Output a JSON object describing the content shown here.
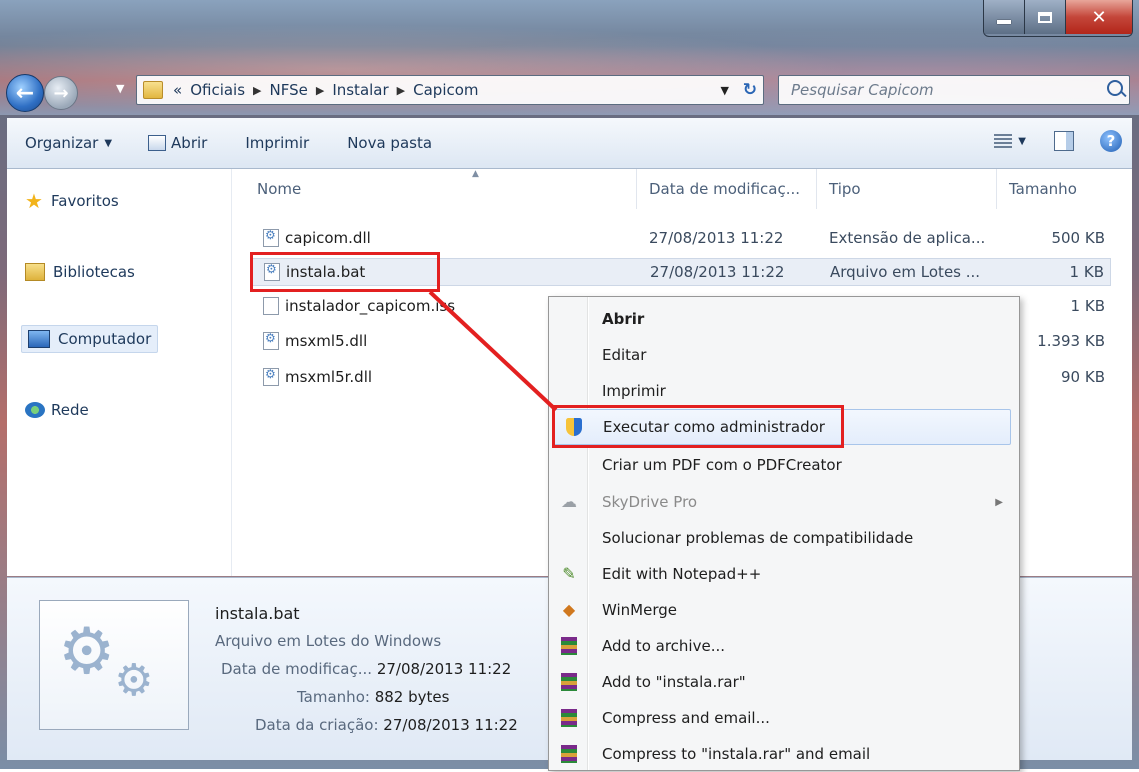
{
  "address": {
    "breadcrumb_prefix": "«",
    "crumbs": [
      "Oficiais",
      "NFSe",
      "Instalar",
      "Capicom"
    ],
    "search_placeholder": "Pesquisar Capicom"
  },
  "toolbar": {
    "organize_label": "Organizar",
    "open_label": "Abrir",
    "print_label": "Imprimir",
    "new_folder_label": "Nova pasta"
  },
  "navpane": {
    "items": [
      "Favoritos",
      "Bibliotecas",
      "Computador",
      "Rede"
    ]
  },
  "columns": [
    "Nome",
    "Data de modificaç...",
    "Tipo",
    "Tamanho"
  ],
  "files": [
    {
      "name": "capicom.dll",
      "date": "27/08/2013 11:22",
      "type": "Extensão de aplica...",
      "size": "500 KB"
    },
    {
      "name": "instala.bat",
      "date": "27/08/2013 11:22",
      "type": "Arquivo em Lotes ...",
      "size": "1 KB"
    },
    {
      "name": "instalador_capicom.iss",
      "date": "",
      "type": "",
      "size": "1 KB"
    },
    {
      "name": "msxml5.dll",
      "date": "",
      "type": "",
      "size": "1.393 KB"
    },
    {
      "name": "msxml5r.dll",
      "date": "",
      "type": "",
      "size": "90 KB"
    }
  ],
  "details": {
    "name": "instala.bat",
    "type": "Arquivo em Lotes do Windows",
    "modified_label": "Data de modificaç...",
    "modified_value": "27/08/2013 11:22",
    "size_label": "Tamanho:",
    "size_value": "882 bytes",
    "created_label": "Data da criação:",
    "created_value": "27/08/2013 11:22"
  },
  "context_menu": {
    "items": [
      "Abrir",
      "Editar",
      "Imprimir",
      "Executar como administrador",
      "Criar um PDF com o PDFCreator",
      "SkyDrive Pro",
      "Solucionar problemas de compatibilidade",
      "Edit with Notepad++",
      "WinMerge",
      "Add to archive...",
      "Add to \"instala.rar\"",
      "Compress and email...",
      "Compress to \"instala.rar\" and email"
    ]
  },
  "colors": {
    "highlight": "#e32020",
    "text": "#1e395b"
  }
}
